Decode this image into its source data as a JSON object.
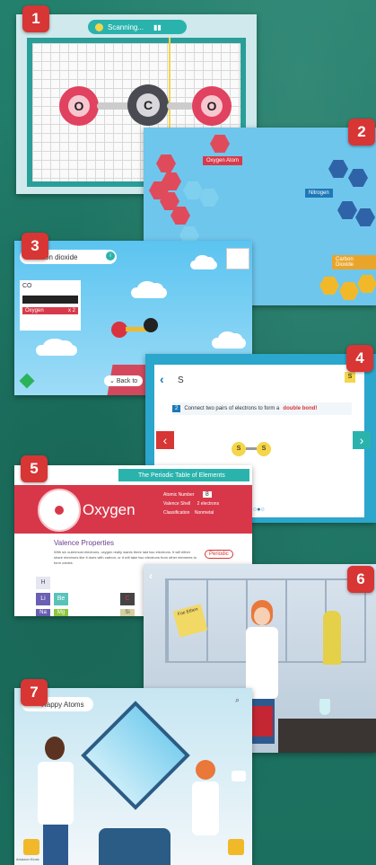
{
  "badges": [
    "1",
    "2",
    "3",
    "4",
    "5",
    "6",
    "7"
  ],
  "panel1": {
    "status": "Scanning...",
    "atoms": [
      "O",
      "C",
      "O"
    ]
  },
  "panel2": {
    "tooltips": [
      "Oxygen Atom",
      "Nitrogen",
      "Carbon Dioxide"
    ]
  },
  "panel3": {
    "title": "Carbon dioxide",
    "formula": "CO",
    "row_label": "Oxygen",
    "row_value": "x 2",
    "back_label": "Back to"
  },
  "panel4": {
    "symbol": "S",
    "step_number": "2",
    "instruction": "Connect two pairs of electrons to form a",
    "highlight": "double bond!",
    "atom_labels": [
      "S",
      "S"
    ]
  },
  "panel5": {
    "header": "The Periodic Table of Elements",
    "element_name": "Oxygen",
    "number_label": "Atomic Number",
    "number_value": "8",
    "shell_label": "Valence Shell",
    "shell_value": "2 electrons",
    "class_label": "Classification",
    "class_value": "Nonmetal",
    "section_title": "Valence Properties",
    "body": "With six outermost electrons, oxygen really wants three last two electrons. It will either share electrons like it does with carbon, or it will take two electrons from other elements to form oxides.",
    "elements": [
      "H",
      "Li",
      "Be",
      "Na",
      "Mg",
      "C",
      "Si"
    ],
    "link": "Periodic"
  },
  "panel6": {
    "sign": "Foe Ethen"
  },
  "panel7": {
    "title": "Happy Atoms",
    "caption": "Amazon Kiosk"
  },
  "colors": {
    "accent_red": "#d83535",
    "teal": "#2bb3a8",
    "sky": "#5ec7ee"
  }
}
